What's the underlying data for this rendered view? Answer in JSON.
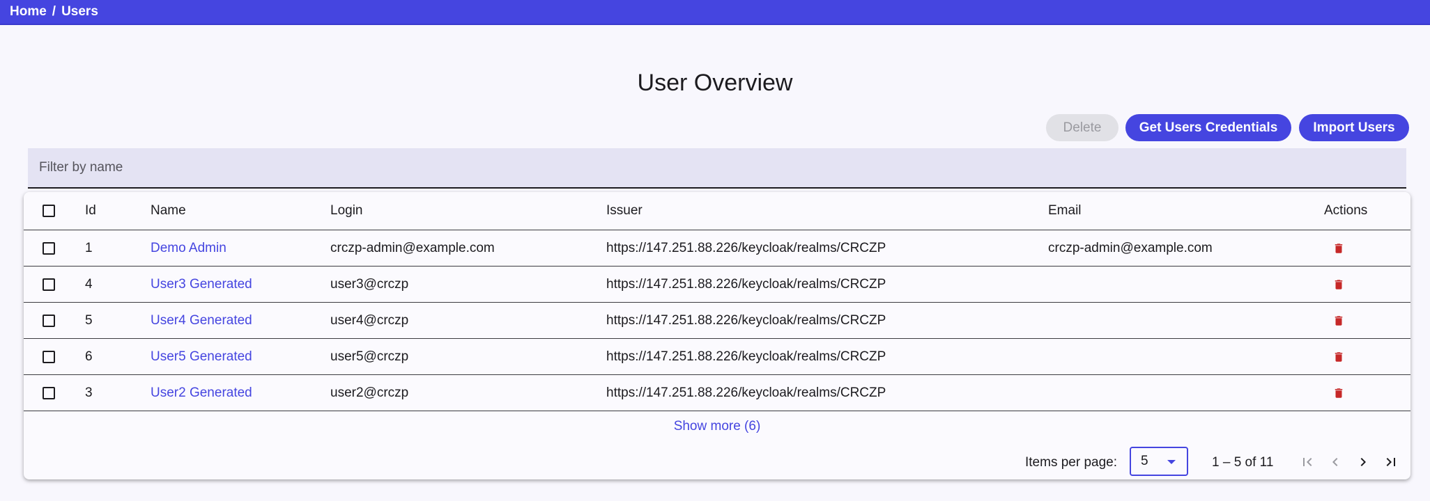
{
  "breadcrumb": {
    "home": "Home",
    "separator": "/",
    "current": "Users"
  },
  "page_title": "User Overview",
  "toolbar": {
    "delete_label": "Delete",
    "credentials_label": "Get Users Credentials",
    "import_label": "Import Users"
  },
  "filter": {
    "placeholder": "Filter by name",
    "value": ""
  },
  "table": {
    "columns": [
      "Id",
      "Name",
      "Login",
      "Issuer",
      "Email",
      "Actions"
    ],
    "rows": [
      {
        "id": "1",
        "name": "Demo Admin",
        "login": "crczp-admin@example.com",
        "issuer": "https://147.251.88.226/keycloak/realms/CRCZP",
        "email": "crczp-admin@example.com"
      },
      {
        "id": "4",
        "name": "User3 Generated",
        "login": "user3@crczp",
        "issuer": "https://147.251.88.226/keycloak/realms/CRCZP",
        "email": ""
      },
      {
        "id": "5",
        "name": "User4 Generated",
        "login": "user4@crczp",
        "issuer": "https://147.251.88.226/keycloak/realms/CRCZP",
        "email": ""
      },
      {
        "id": "6",
        "name": "User5 Generated",
        "login": "user5@crczp",
        "issuer": "https://147.251.88.226/keycloak/realms/CRCZP",
        "email": ""
      },
      {
        "id": "3",
        "name": "User2 Generated",
        "login": "user2@crczp",
        "issuer": "https://147.251.88.226/keycloak/realms/CRCZP",
        "email": ""
      }
    ],
    "show_more": "Show more (6)"
  },
  "paginator": {
    "items_per_page_label": "Items per page:",
    "items_per_page_value": "5",
    "range": "1 – 5 of 11"
  },
  "colors": {
    "accent": "#4545e0",
    "danger": "#c62828",
    "background": "#f8f7fd"
  },
  "icons": {
    "delete": "trash-icon",
    "first": "first-page-icon",
    "prev": "chevron-left-icon",
    "next": "chevron-right-icon",
    "last": "last-page-icon"
  }
}
